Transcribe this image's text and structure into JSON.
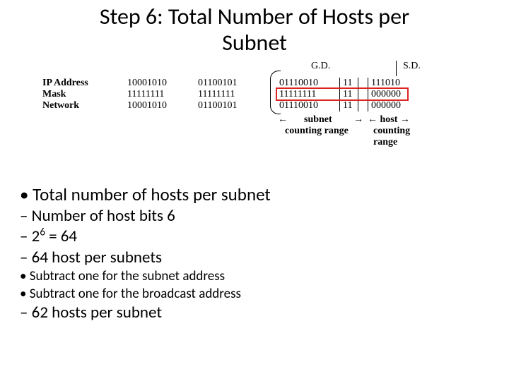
{
  "title_line1": "Step 6: Total Number of Hosts per",
  "title_line2": "Subnet",
  "diagram": {
    "hdr_gd": "G.D.",
    "hdr_sd": "S.D.",
    "rowlabel1": "IP Address",
    "rowlabel2": "Mask",
    "rowlabel3": "Network",
    "col1": {
      "r1": "10001010",
      "r2": "11111111",
      "r3": "10001010"
    },
    "col2": {
      "r1": "01100101",
      "r2": "11111111",
      "r3": "01100101"
    },
    "col3": {
      "r1": "01110010",
      "r2": "11111111",
      "r3": "01110010"
    },
    "col4": {
      "r1": "11",
      "r2": "11",
      "r3": "11"
    },
    "col5": {
      "r1": "111010",
      "r2": "000000",
      "r3": "000000"
    },
    "subnet_arrow_left": "←",
    "subnet_arrow_right": "→",
    "subnet_label": "subnet",
    "host_label": "← host →",
    "counting": "counting",
    "range": "range",
    "counting2": "counting range"
  },
  "bul": {
    "l1": "Total number of hosts per subnet",
    "l2a": "Number of host bits 6",
    "l2b_pre": "2",
    "l2b_sup": "6",
    "l2b_post": " = 64",
    "l2c": "64 host per subnets",
    "l3a": "Subtract one for the subnet address",
    "l3b": "Subtract one for the broadcast address",
    "l2d": "62 hosts per subnet"
  }
}
